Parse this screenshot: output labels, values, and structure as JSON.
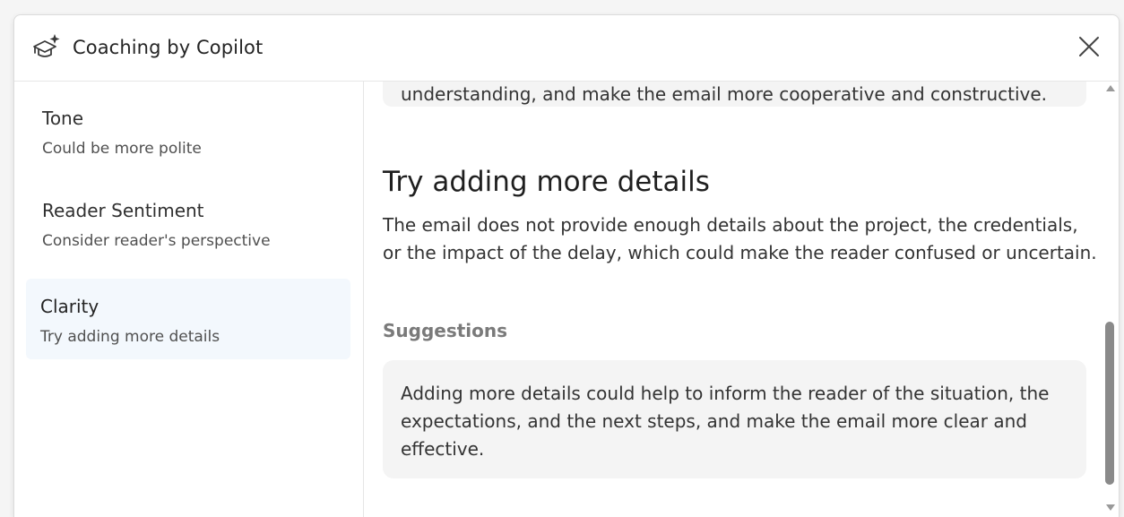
{
  "header": {
    "title": "Coaching by Copilot",
    "app_icon": "graduation-cap-sparkle-icon",
    "close_icon": "close-icon"
  },
  "sidebar": {
    "items": [
      {
        "label": "Tone",
        "subtitle": "Could be more polite",
        "selected": false
      },
      {
        "label": "Reader Sentiment",
        "subtitle": "Consider reader's perspective",
        "selected": false
      },
      {
        "label": "Clarity",
        "subtitle": "Try adding more details",
        "selected": true
      }
    ]
  },
  "main": {
    "previous_suggestion_text": "understanding, and make the email more cooperative and constructive.",
    "section_title": "Try adding more details",
    "section_description": "The email does not provide enough details about the project, the credentials, or the impact of the delay, which could make the reader confused or uncertain.",
    "suggestions_label": "Suggestions",
    "suggestion_text": "Adding more details could help to inform the reader of the situation, the expectations, and the next steps, and make the email more clear and effective."
  },
  "colors": {
    "selected_item_bg": "#f3f8fd",
    "card_bg": "#f4f4f4",
    "scroll_thumb": "#8a8a8a"
  }
}
